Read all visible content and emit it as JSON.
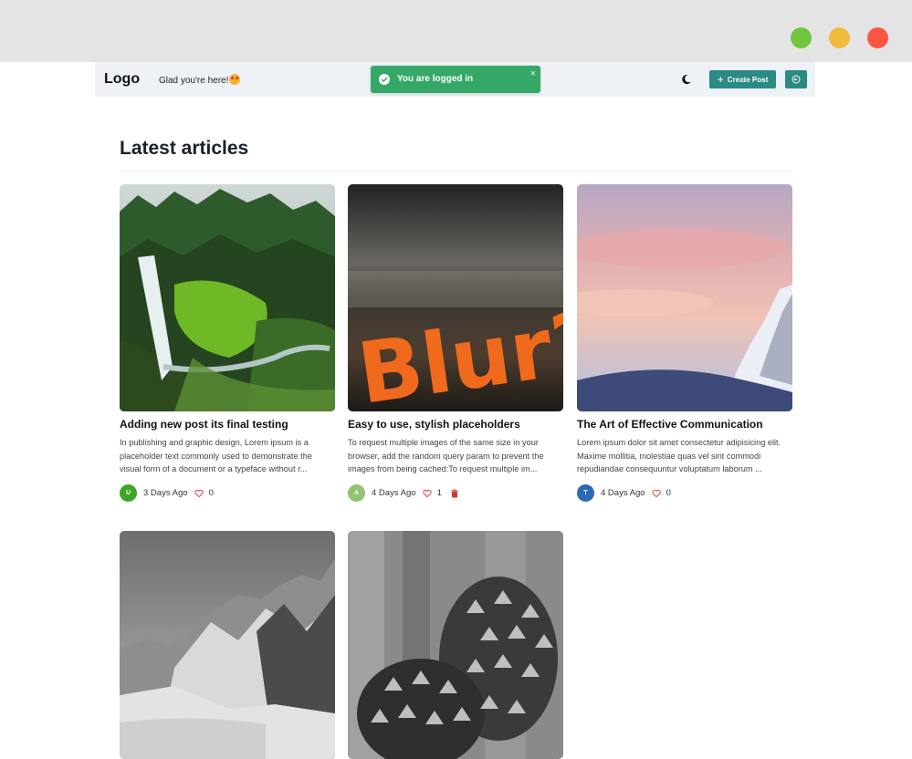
{
  "window": {
    "controls": [
      "maximize",
      "minimize",
      "close"
    ]
  },
  "navbar": {
    "logo": "Logo",
    "greeting": "Glad you're here!",
    "theme_icon": "moon-icon",
    "create_label": "Create Post",
    "logout_icon": "logout-icon"
  },
  "toast": {
    "message": "You are logged in",
    "close": "×",
    "icon": "check-circle-icon",
    "color": "#35a868"
  },
  "section_title": "Latest articles",
  "colors": {
    "accent": "#2b8a83",
    "heart": "#e0424f",
    "trash": "#d9302c"
  },
  "articles": [
    {
      "title": "Adding new post its final testing",
      "excerpt": "In publishing and graphic design, Lorem ipsum is a placeholder text commonly used to demonstrate the visual form of a document or a typeface without r...",
      "avatar": "U",
      "avatar_color": "#3fa524",
      "time": "3 Days Ago",
      "likes": "0",
      "image": "waterfall forest"
    },
    {
      "title": "Easy to use, stylish placeholders",
      "excerpt": "To request multiple images of the same size in your browser, add the random query param to prevent the images from being cached:To request multiple im...",
      "avatar": "A",
      "avatar_color": "#92c46f",
      "time": "4 Days Ago",
      "likes": "1",
      "image_text": "Blur?"
    },
    {
      "title": "The Art of Effective Communication",
      "excerpt": "Lorem ipsum dolor sit amet consectetur adipisicing elit. Maxime mollitia, molestiae quas vel sint commodi repudiandae consequuntur voluptatum laborum ...",
      "avatar": "T",
      "avatar_color": "#2e69b8",
      "time": "4 Days Ago",
      "likes": "0",
      "image": "snowy mountain at dusk"
    },
    {
      "image": "grayscale mountains"
    },
    {
      "image": "grayscale pinecones"
    }
  ]
}
